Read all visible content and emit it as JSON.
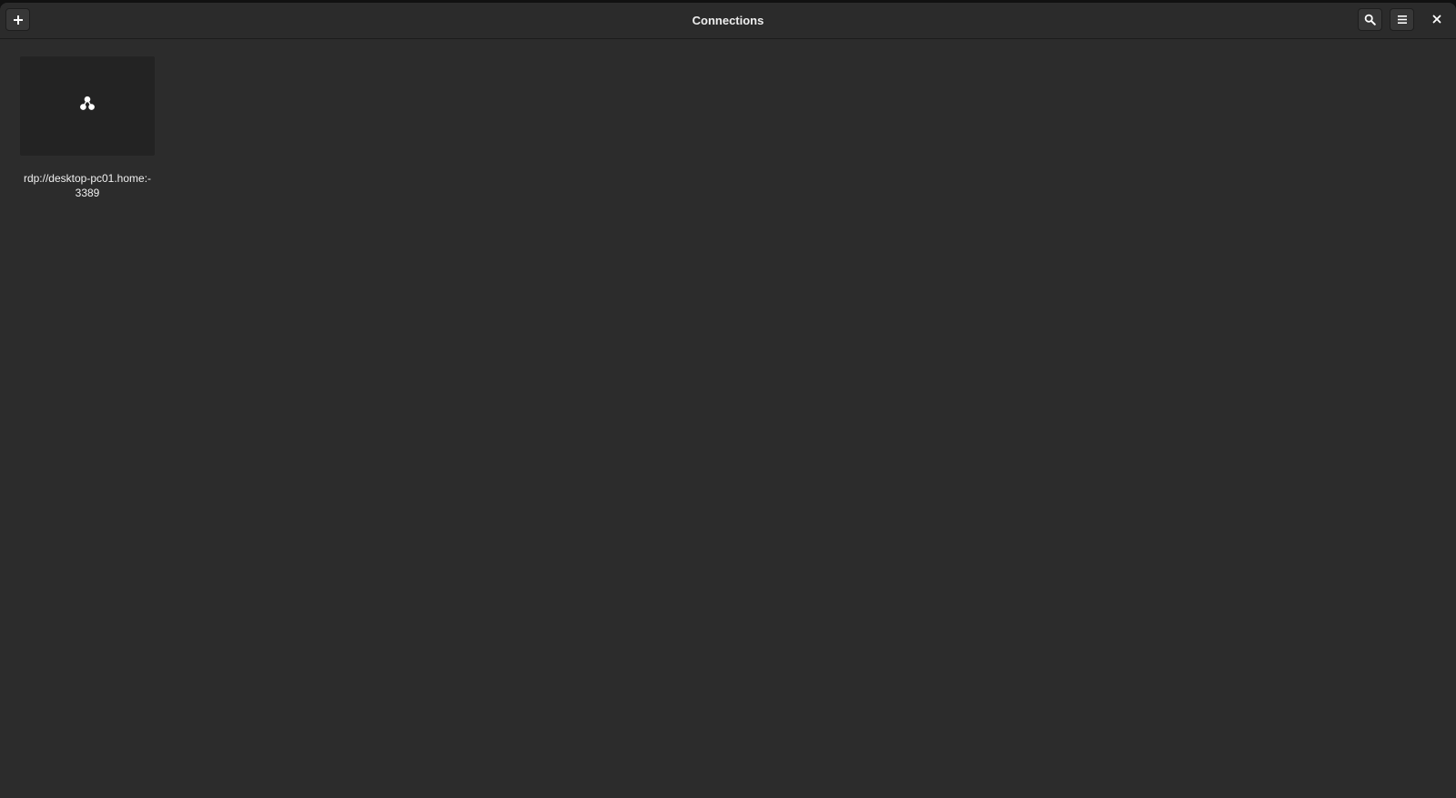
{
  "window": {
    "title": "Connections"
  },
  "headerbar": {
    "add_icon": "plus-icon",
    "search_icon": "search-icon",
    "menu_icon": "hamburger-menu-icon",
    "close_icon": "close-icon"
  },
  "connections": [
    {
      "label": "rdp://desktop-pc01.home:-\n3389",
      "icon": "remote-desktop-icon"
    }
  ],
  "colors": {
    "window_bg": "#2c2c2c",
    "headerbar_bg": "#2b2b2b",
    "thumbnail_bg": "#232323",
    "text": "#f0f0f0"
  }
}
